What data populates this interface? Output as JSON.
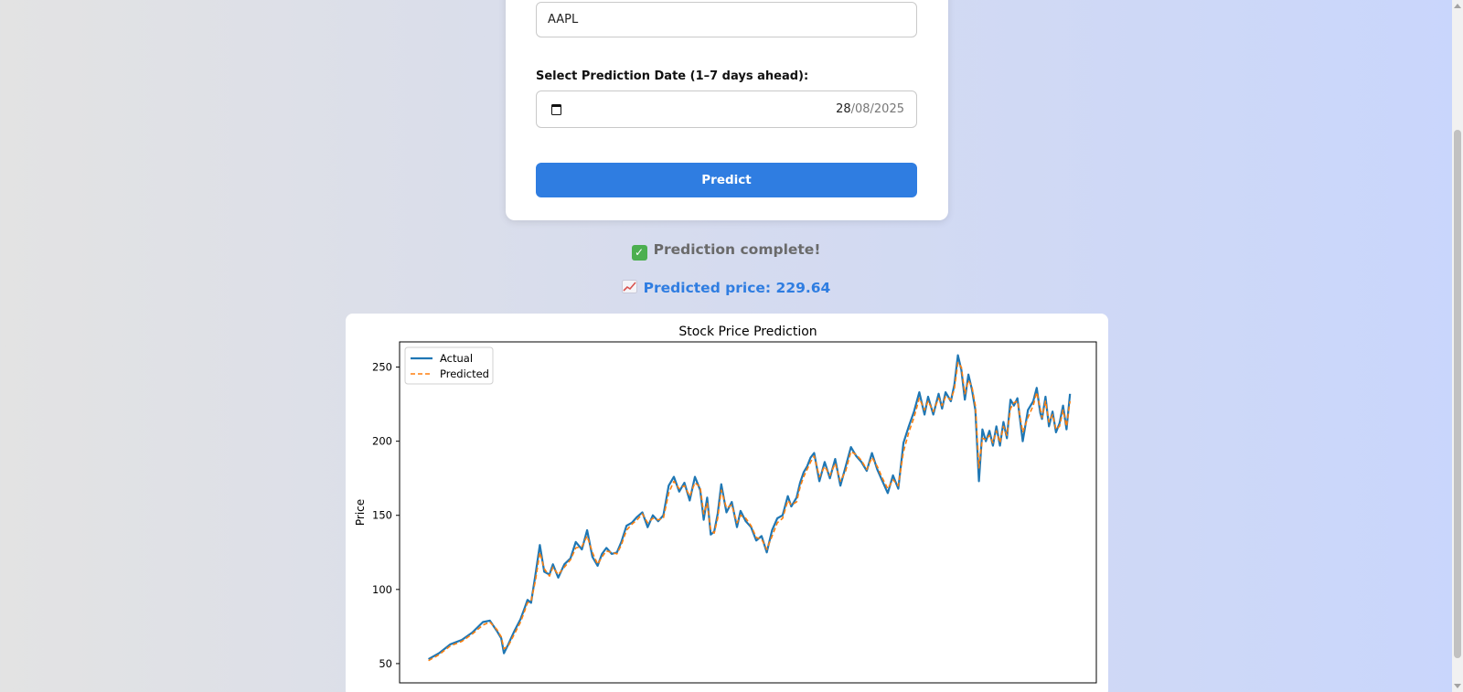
{
  "form": {
    "ticker_value": "AAPL",
    "date_label": "Select Prediction Date (1–7 days ahead):",
    "date_day": "28",
    "date_rest": "/08/2025",
    "predict_label": "Predict"
  },
  "status": {
    "complete_text": "Prediction complete!",
    "predicted_text": "Predicted price: 229.64"
  },
  "colors": {
    "accent": "#2f7de1",
    "actual_line": "#1f77b4",
    "predicted_line": "#ff7f0e"
  },
  "chart_data": {
    "type": "line",
    "title": "Stock Price Prediction",
    "xlabel": "",
    "ylabel": "Price",
    "ylim": [
      37,
      267
    ],
    "yticks": [
      50,
      100,
      150,
      200,
      250
    ],
    "legend_position": "top-left",
    "grid": false,
    "x": [
      0,
      12,
      25,
      38,
      50,
      62,
      70,
      78,
      83,
      86,
      91,
      98,
      105,
      110,
      113,
      117,
      122,
      127,
      132,
      138,
      142,
      148,
      155,
      162,
      168,
      175,
      181,
      187,
      193,
      198,
      203,
      209,
      215,
      220,
      226,
      232,
      238,
      244,
      250,
      256,
      262,
      268,
      274,
      280,
      286,
      292,
      298,
      304,
      310,
      314,
      318,
      322,
      326,
      330,
      334,
      340,
      346,
      352,
      356,
      362,
      368,
      374,
      380,
      386,
      392,
      398,
      404,
      410,
      414,
      420,
      424,
      428,
      432,
      436,
      440,
      446,
      452,
      458,
      464,
      470,
      476,
      482,
      488,
      494,
      500,
      506,
      512,
      518,
      524,
      530,
      536,
      542,
      548,
      554,
      560,
      566,
      570,
      576,
      582,
      586,
      590,
      596,
      600,
      604,
      608,
      612,
      616,
      620,
      624,
      628,
      632,
      636,
      640,
      644,
      648,
      652,
      656,
      660,
      664,
      668,
      672,
      678,
      684,
      690,
      694,
      698,
      700,
      704,
      708,
      712,
      716,
      720,
      724,
      728,
      732,
      736,
      740
    ],
    "series": [
      {
        "name": "Actual",
        "values": [
          53,
          57,
          63,
          66,
          71,
          78,
          79,
          72,
          67,
          57,
          63,
          72,
          80,
          88,
          93,
          91,
          110,
          130,
          112,
          110,
          117,
          108,
          117,
          121,
          132,
          127,
          140,
          122,
          116,
          124,
          128,
          124,
          125,
          132,
          143,
          145,
          149,
          152,
          142,
          150,
          146,
          150,
          170,
          176,
          166,
          172,
          160,
          176,
          167,
          147,
          162,
          137,
          139,
          151,
          171,
          152,
          159,
          142,
          153,
          146,
          142,
          133,
          136,
          125,
          140,
          148,
          150,
          163,
          156,
          162,
          172,
          179,
          183,
          189,
          192,
          173,
          186,
          175,
          188,
          170,
          183,
          196,
          190,
          186,
          180,
          192,
          181,
          173,
          165,
          177,
          168,
          199,
          210,
          220,
          233,
          218,
          230,
          218,
          232,
          222,
          233,
          227,
          238,
          258,
          248,
          228,
          245,
          235,
          221,
          173,
          208,
          200,
          207,
          197,
          210,
          197,
          213,
          202,
          228,
          224,
          229,
          200,
          221,
          227,
          236,
          219,
          215,
          230,
          210,
          220,
          206,
          212,
          224,
          208,
          232
        ],
        "style": "solid"
      },
      {
        "name": "Predicted",
        "values": [
          52,
          56,
          62,
          65,
          70,
          76,
          78,
          73,
          68,
          60,
          62,
          70,
          78,
          86,
          91,
          92,
          106,
          125,
          114,
          109,
          115,
          110,
          115,
          120,
          128,
          129,
          136,
          125,
          117,
          122,
          126,
          125,
          124,
          130,
          140,
          144,
          147,
          151,
          145,
          148,
          147,
          148,
          165,
          173,
          168,
          170,
          163,
          172,
          169,
          151,
          158,
          140,
          138,
          148,
          167,
          155,
          157,
          145,
          150,
          148,
          143,
          135,
          134,
          127,
          136,
          145,
          148,
          160,
          157,
          159,
          169,
          176,
          181,
          186,
          190,
          176,
          183,
          177,
          185,
          173,
          180,
          193,
          191,
          187,
          181,
          189,
          183,
          175,
          168,
          174,
          170,
          193,
          206,
          216,
          229,
          221,
          227,
          220,
          229,
          224,
          230,
          228,
          235,
          253,
          250,
          232,
          241,
          237,
          224,
          182,
          202,
          201,
          204,
          199,
          207,
          199,
          210,
          204,
          222,
          226,
          227,
          206,
          216,
          224,
          233,
          222,
          216,
          227,
          213,
          218,
          208,
          210,
          221,
          210,
          227
        ],
        "style": "dashed"
      }
    ],
    "annotation_order": [
      "Actual",
      "Predicted"
    ]
  }
}
